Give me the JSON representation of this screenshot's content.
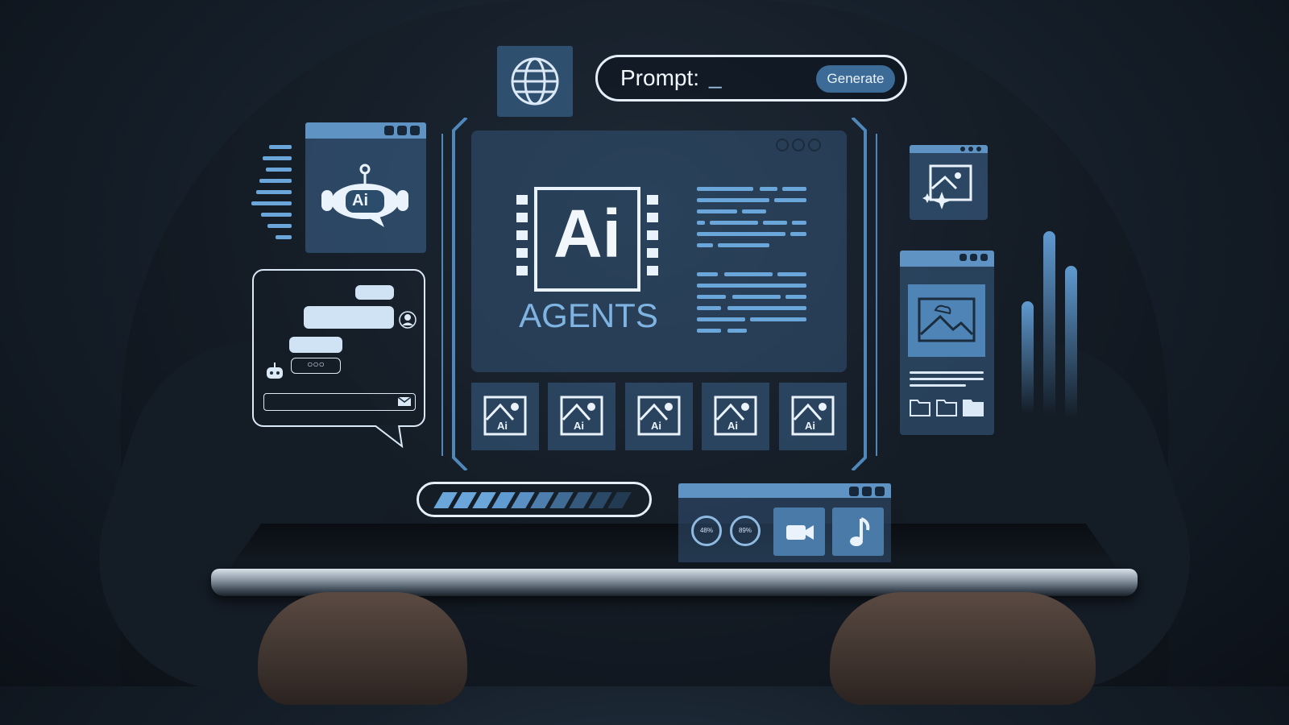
{
  "prompt": {
    "label": "Prompt:",
    "cursor": "_",
    "button": "Generate"
  },
  "center": {
    "logo": "Ai",
    "title": "AGENTS"
  },
  "thumbnails": [
    {
      "label": "Ai"
    },
    {
      "label": "Ai"
    },
    {
      "label": "Ai"
    },
    {
      "label": "Ai"
    },
    {
      "label": "Ai"
    }
  ],
  "robot_card": {
    "label": "Ai"
  },
  "media": {
    "gauge_1": "48%",
    "gauge_2": "89%"
  },
  "progress": {
    "fraction": 0.75
  },
  "colors": {
    "accent": "#5f93c4",
    "outline": "#e4effa",
    "text_blue": "#7eb3e2"
  },
  "icons": [
    "globe-icon",
    "robot-icon",
    "image-icon",
    "video-icon",
    "music-icon",
    "folder-icon",
    "envelope-icon",
    "user-icon"
  ]
}
